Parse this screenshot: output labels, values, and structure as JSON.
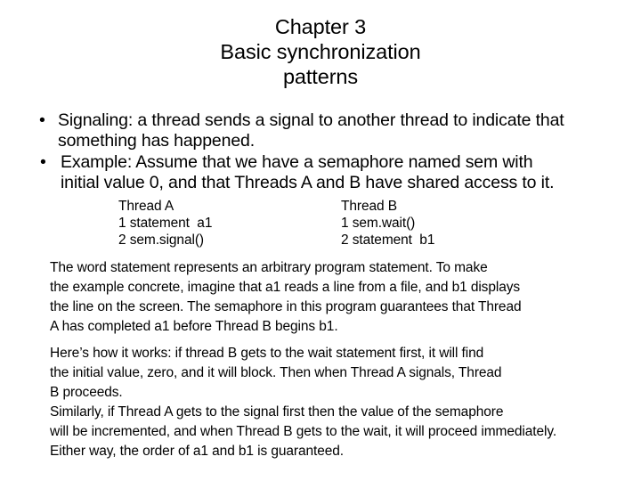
{
  "slide": {
    "background_color": "#ffffff",
    "text_color": "#000000",
    "title": {
      "line1": "Chapter 3",
      "line2": "Basic synchronization",
      "line3": "patterns"
    },
    "bullets": [
      {
        "marker": "•",
        "line1": "Signaling: a thread sends a signal to another thread to indicate that",
        "line2": "something has happened."
      },
      {
        "marker": "•",
        "line1": "Example:   Assume that we have a semaphore named sem with",
        "line2": "initial value 0, and that Threads A and B have shared access to it."
      }
    ],
    "threads": {
      "thread_a": {
        "header": "Thread A",
        "line1": "1 statement  a1",
        "line2": "2 sem.signal()"
      },
      "thread_b": {
        "header": "Thread B",
        "line1": "1 sem.wait()",
        "line2": "2 statement  b1"
      }
    },
    "paragraphs": [
      {
        "line1": "The word statement represents an arbitrary program statement. To make",
        "line2": "the example concrete, imagine that a1 reads a line from a file, and b1 displays",
        "line3": "the line on the screen. The semaphore in this program guarantees that Thread",
        "line4": "A has completed a1 before Thread B begins b1."
      },
      {
        "line1": "Here’s how it works: if thread B gets to the wait statement first, it will find",
        "line2": "the initial value, zero, and it will block. Then when Thread A signals, Thread",
        "line3": "B proceeds.",
        "line4": "Similarly, if Thread A gets to the signal first then the value of the semaphore",
        "line5": "will be incremented, and when Thread B gets to the wait, it will proceed immediately.",
        "line6": "Either way, the order of a1 and b1 is guaranteed."
      }
    ]
  }
}
